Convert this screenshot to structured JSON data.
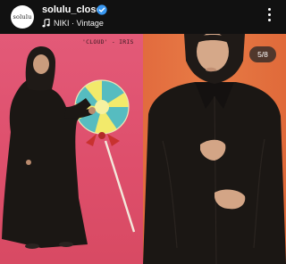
{
  "post": {
    "username": "solulu_closet",
    "avatar_text": "solulu",
    "track": "NIKI · Vintage",
    "verified": true
  },
  "carousel": {
    "caption": "'CLOUD' - IRIS",
    "counter": "5/8"
  },
  "icons": [
    "verified-badge-icon",
    "music-note-icon",
    "more-options-icon"
  ],
  "colors": {
    "left_background": "#e35a78",
    "right_background": "#e77b45",
    "garment": "#1b1714",
    "verified": "#3897f0"
  }
}
